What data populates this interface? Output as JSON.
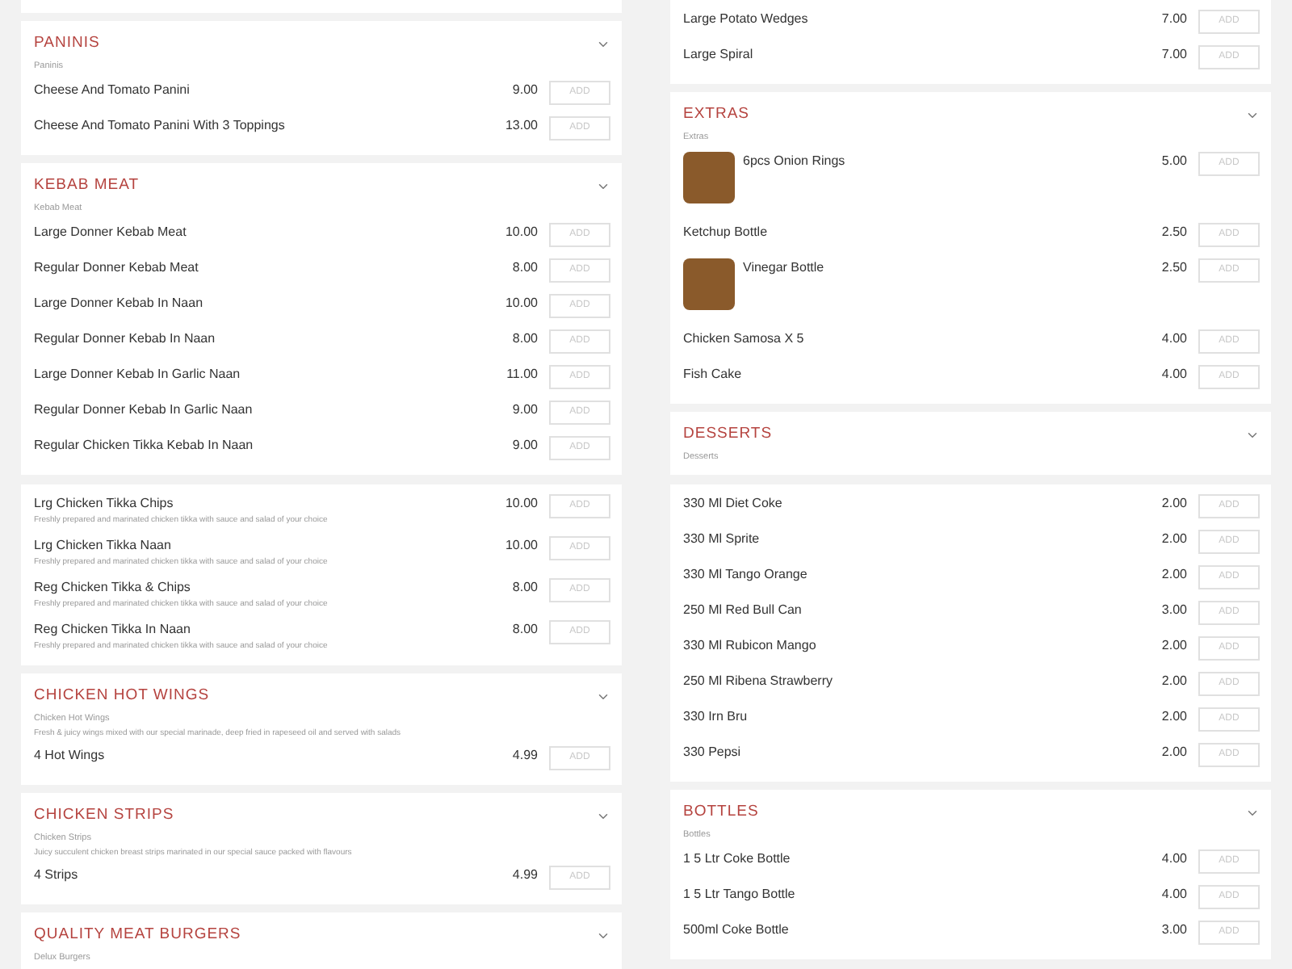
{
  "quadrants": [
    {
      "cards": [
        {
          "title": "PANINIS",
          "subtitle": "Paninis",
          "items": [
            {
              "name": "Cheese And Tomato Panini",
              "price": "9.00",
              "button": "ADD"
            },
            {
              "name": "Cheese And Tomato Panini With 3 Toppings",
              "price": "13.00",
              "button": "ADD"
            }
          ]
        },
        {
          "title": "KEBAB MEAT",
          "subtitle": "Kebab Meat",
          "items": [
            {
              "name": "Large Donner Kebab Meat",
              "price": "10.00",
              "button": "ADD"
            },
            {
              "name": "Regular Donner Kebab Meat",
              "price": "8.00",
              "button": "ADD"
            },
            {
              "name": "Large Donner Kebab In Naan",
              "price": "10.00",
              "button": "ADD"
            },
            {
              "name": "Regular Donner Kebab In Naan",
              "price": "8.00",
              "button": "ADD"
            },
            {
              "name": "Large Donner Kebab In Garlic Naan",
              "price": "11.00",
              "button": "ADD"
            },
            {
              "name": "Regular Donner Kebab In Garlic Naan",
              "price": "9.00",
              "button": "ADD"
            },
            {
              "name": "Regular Chicken Tikka Kebab In Naan",
              "price": "9.00",
              "button": "ADD"
            }
          ]
        }
      ]
    },
    {
      "cards": [
        {
          "items": [
            {
              "name": "Lrg Chicken Tikka Chips",
              "description": "Freshly prepared and marinated chicken tikka with sauce and salad of your choice",
              "price": "10.00",
              "button": "ADD"
            },
            {
              "name": "Lrg Chicken Tikka Naan",
              "description": "Freshly prepared and marinated chicken tikka with sauce and salad of your choice",
              "price": "10.00",
              "button": "ADD"
            },
            {
              "name": "Reg Chicken Tikka & Chips",
              "description": "Freshly prepared and marinated chicken tikka with sauce and salad of your choice",
              "price": "8.00",
              "button": "ADD"
            },
            {
              "name": "Reg Chicken Tikka In Naan",
              "description": "Freshly prepared and marinated chicken tikka with sauce and salad of your choice",
              "price": "8.00",
              "button": "ADD"
            }
          ]
        },
        {
          "title": "CHICKEN HOT WINGS",
          "subtitle": "Chicken Hot Wings",
          "description": "Fresh & juicy wings mixed with our special marinade, deep fried in rapeseed oil and served with salads",
          "items": [
            {
              "name": "4 Hot Wings",
              "price": "4.99",
              "button": "ADD"
            }
          ]
        },
        {
          "title": "CHICKEN STRIPS",
          "subtitle": "Chicken Strips",
          "description": "Juicy succulent chicken breast strips marinated in our special sauce packed with flavours",
          "items": [
            {
              "name": "4 Strips",
              "price": "4.99",
              "button": "ADD"
            }
          ]
        },
        {
          "title": "QUALITY MEAT BURGERS",
          "subtitle": "Delux Burgers"
        }
      ]
    },
    {
      "cards": [
        {
          "items": [
            {
              "name": "Large Potato Wedges",
              "price": "7.00",
              "button": "ADD"
            },
            {
              "name": "Large Spiral",
              "price": "7.00",
              "button": "ADD"
            }
          ]
        },
        {
          "title": "EXTRAS",
          "subtitle": "Extras",
          "items": [
            {
              "kind": "photo",
              "name": "6pcs Onion Rings",
              "price": "5.00",
              "button": "ADD"
            },
            {
              "name": "Ketchup Bottle",
              "price": "2.50",
              "button": "ADD"
            },
            {
              "kind": "photo",
              "name": "Vinegar Bottle",
              "price": "2.50",
              "button": "ADD"
            },
            {
              "name": "Chicken Samosa X 5",
              "price": "4.00",
              "button": "ADD"
            },
            {
              "name": "Fish Cake",
              "price": "4.00",
              "button": "ADD"
            }
          ]
        },
        {
          "title": "DESSERTS",
          "subtitle": "Desserts"
        }
      ]
    },
    {
      "cards": [
        {
          "items": [
            {
              "name": "330 Ml Diet Coke",
              "price": "2.00",
              "button": "ADD"
            },
            {
              "name": "330 Ml Sprite",
              "price": "2.00",
              "button": "ADD"
            },
            {
              "name": "330 Ml Tango Orange",
              "price": "2.00",
              "button": "ADD"
            },
            {
              "name": "250 Ml Red Bull Can",
              "price": "3.00",
              "button": "ADD"
            },
            {
              "name": "330 Ml Rubicon Mango",
              "price": "2.00",
              "button": "ADD"
            },
            {
              "name": "250 Ml Ribena Strawberry",
              "price": "2.00",
              "button": "ADD"
            },
            {
              "name": "330 Irn Bru",
              "price": "2.00",
              "button": "ADD"
            },
            {
              "name": "330 Pepsi",
              "price": "2.00",
              "button": "ADD"
            }
          ]
        },
        {
          "title": "BOTTLES",
          "subtitle": "Bottles",
          "items": [
            {
              "name": "1 5 Ltr Coke Bottle",
              "price": "4.00",
              "button": "ADD"
            },
            {
              "name": "1 5 Ltr Tango Bottle",
              "price": "4.00",
              "button": "ADD"
            },
            {
              "name": "500ml Coke Bottle",
              "price": "3.00",
              "button": "ADD"
            }
          ]
        }
      ]
    }
  ]
}
